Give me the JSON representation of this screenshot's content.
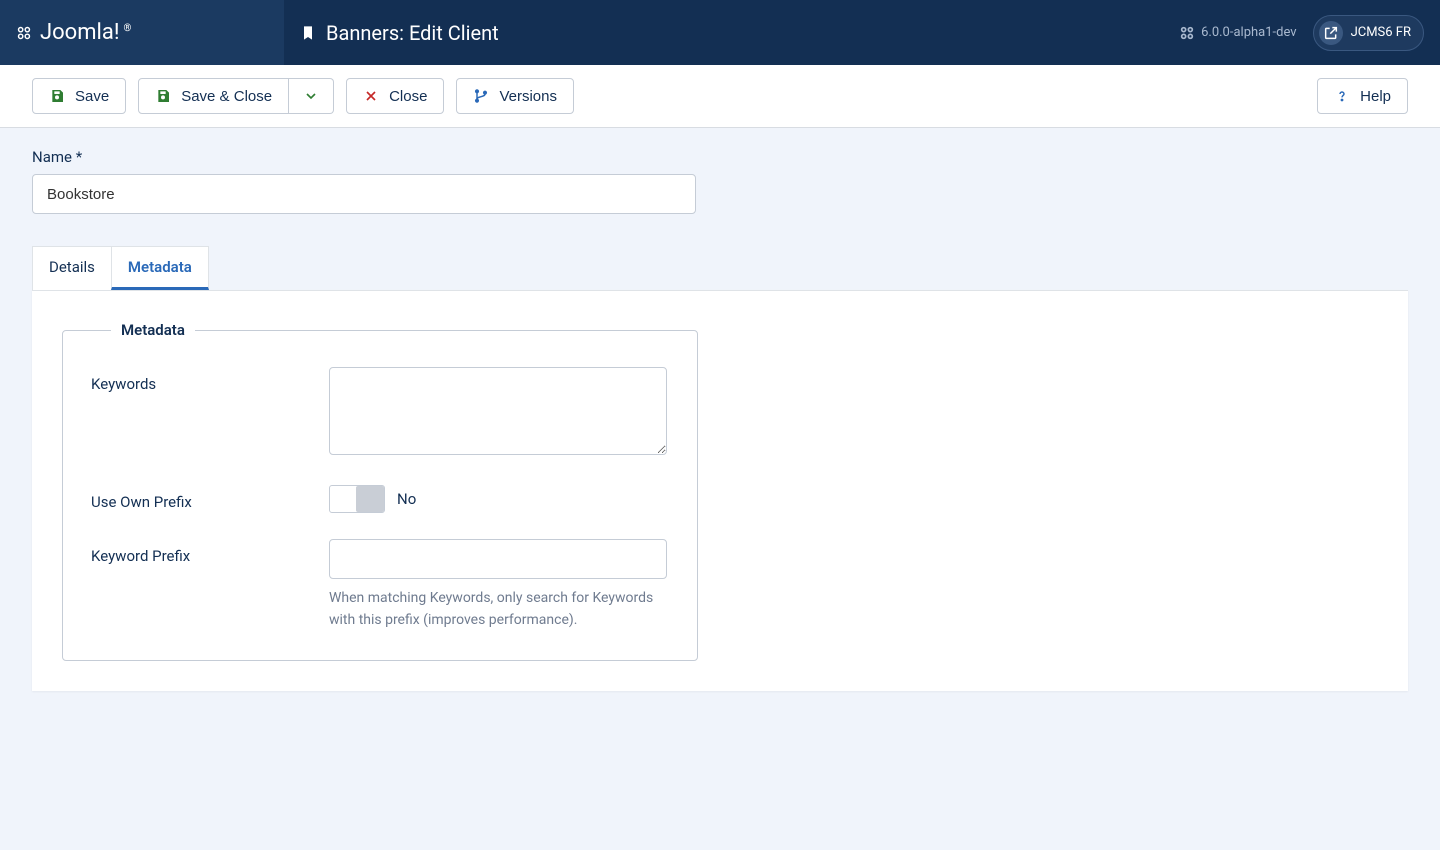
{
  "header": {
    "logo_text": "Joomla!",
    "page_title": "Banners: Edit Client",
    "version": "6.0.0-alpha1-dev",
    "site_name": "JCMS6 FR"
  },
  "toolbar": {
    "save": "Save",
    "save_close": "Save & Close",
    "close": "Close",
    "versions": "Versions",
    "help": "Help"
  },
  "form": {
    "name_label": "Name *",
    "name_value": "Bookstore"
  },
  "tabs": {
    "details": "Details",
    "metadata": "Metadata",
    "active": "metadata"
  },
  "metadata": {
    "legend": "Metadata",
    "keywords_label": "Keywords",
    "keywords_value": "",
    "use_own_prefix_label": "Use Own Prefix",
    "use_own_prefix_value": "No",
    "keyword_prefix_label": "Keyword Prefix",
    "keyword_prefix_value": "",
    "keyword_prefix_help": "When matching Keywords, only search for Keywords with this prefix (improves performance)."
  }
}
